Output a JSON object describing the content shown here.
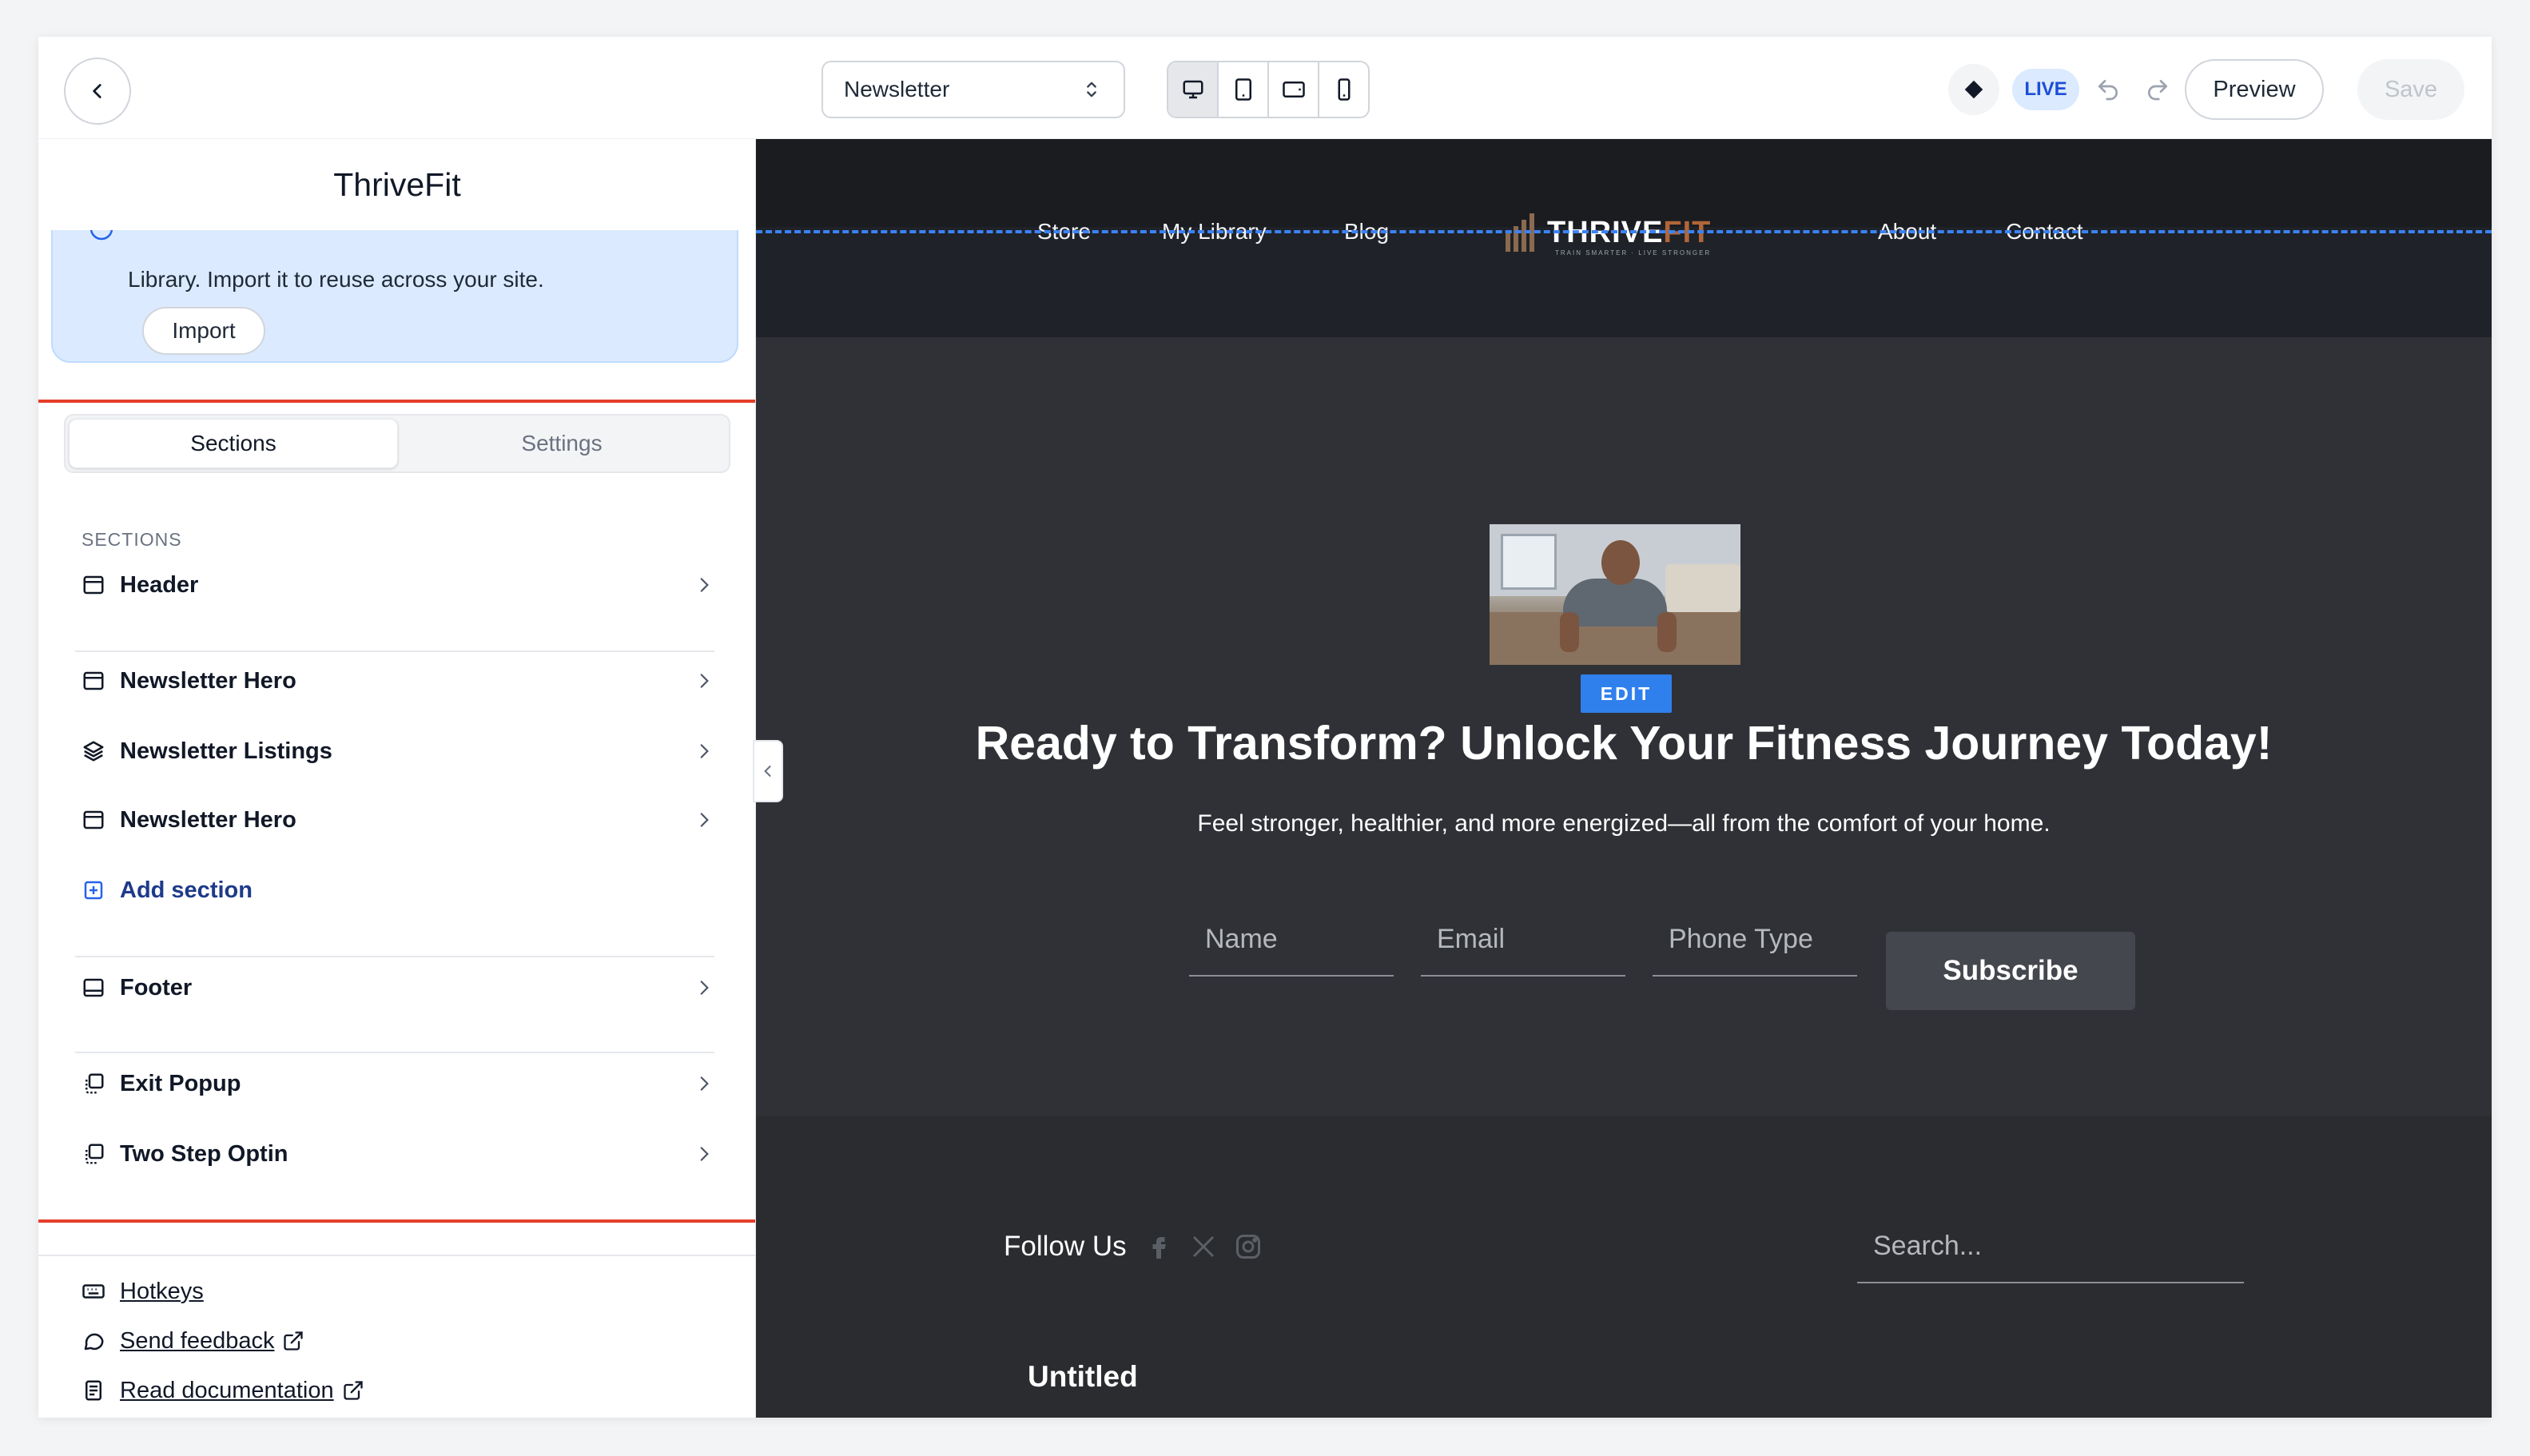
{
  "topbar": {
    "page_selector": "Newsletter",
    "live_badge": "LIVE",
    "preview_label": "Preview",
    "save_label": "Save",
    "devices": [
      "desktop",
      "tablet-portrait",
      "tablet-landscape",
      "mobile"
    ],
    "active_device": "desktop"
  },
  "left_panel": {
    "site_name": "ThriveFit",
    "import_notice": "Library. Import it to reuse across your site.",
    "import_button": "Import",
    "tabs": [
      {
        "label": "Sections",
        "active": true
      },
      {
        "label": "Settings",
        "active": false
      }
    ],
    "sections_heading": "SECTIONS",
    "sections": [
      {
        "label": "Header",
        "icon": "header-section-icon"
      },
      {
        "label": "Newsletter Hero",
        "icon": "section-icon"
      },
      {
        "label": "Newsletter Listings",
        "icon": "layers-icon"
      },
      {
        "label": "Newsletter Hero",
        "icon": "section-icon"
      },
      {
        "label": "Add section",
        "icon": "plus-square-icon"
      },
      {
        "label": "Footer",
        "icon": "footer-section-icon"
      },
      {
        "label": "Exit Popup",
        "icon": "popup-icon"
      },
      {
        "label": "Two Step Optin",
        "icon": "popup-icon"
      }
    ],
    "footer_links": [
      {
        "label": "Hotkeys",
        "icon": "keyboard-icon"
      },
      {
        "label": "Send feedback",
        "icon": "chat-bubble-icon"
      },
      {
        "label": "Read documentation",
        "icon": "document-icon"
      }
    ]
  },
  "canvas": {
    "nav_links": [
      "Store",
      "My Library",
      "Blog",
      "About",
      "Contact"
    ],
    "logo": {
      "text_primary": "THRIVE",
      "text_accent": "FIT",
      "tagline": "TRAIN SMARTER · LIVE STRONGER"
    },
    "edit_badge": "EDIT",
    "hero_heading": "Ready to Transform? Unlock Your Fitness Journey Today!",
    "hero_subheading": "Feel stronger, healthier, and more energized—all from the comfort of your home.",
    "form": {
      "name_placeholder": "Name",
      "email_placeholder": "Email",
      "phone_placeholder": "Phone Type",
      "submit_label": "Subscribe"
    },
    "footer": {
      "follow_us": "Follow Us",
      "social": [
        "facebook-icon",
        "x-icon",
        "instagram-icon"
      ],
      "search_placeholder": "Search...",
      "untitled": "Untitled"
    }
  },
  "colors": {
    "accent": "#2f80ed",
    "selection_outline": "#e53e2a",
    "canvas_bg": "#2f3136",
    "live_badge_bg": "#dbeafe"
  }
}
